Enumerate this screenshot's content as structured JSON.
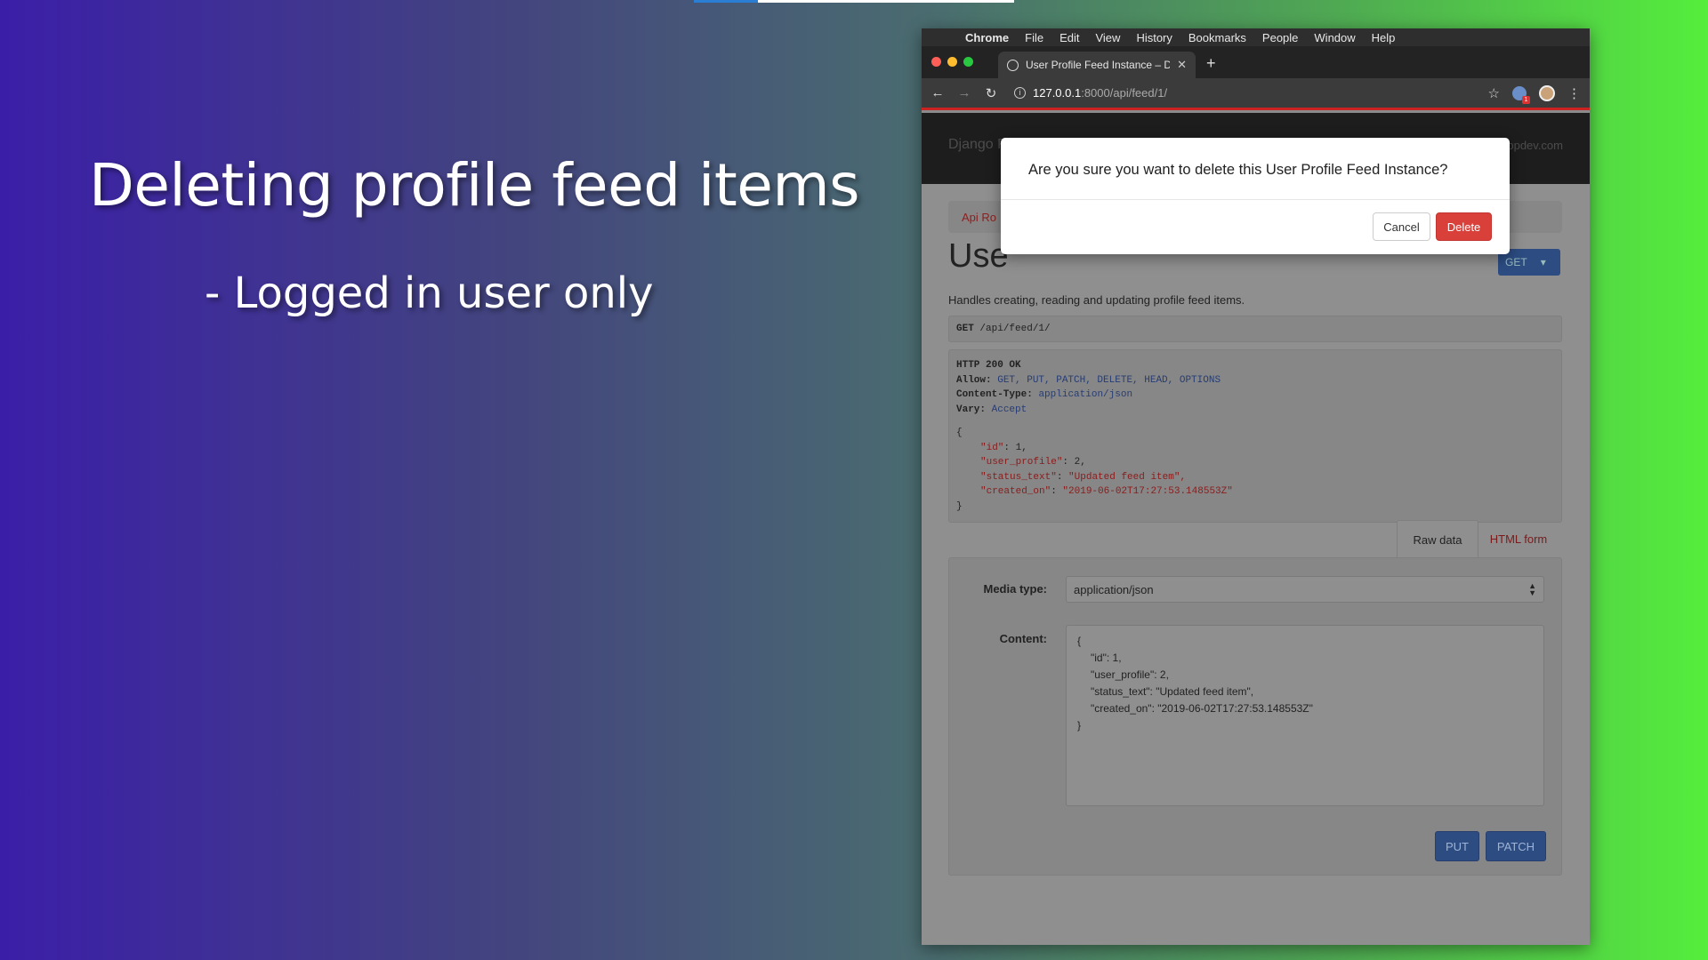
{
  "slide": {
    "title": "Deleting profile feed items",
    "bullet": "- Logged in user only"
  },
  "menubar": {
    "apple_icon": "apple-icon",
    "items": [
      "Chrome",
      "File",
      "Edit",
      "View",
      "History",
      "Bookmarks",
      "People",
      "Window",
      "Help"
    ]
  },
  "browser": {
    "tab_title": "User Profile Feed Instance – Dj",
    "url_host": "127.0.0.1",
    "url_path": ":8000/api/feed/1/",
    "extension_badge": "1"
  },
  "drf": {
    "brand": "Django REST framework",
    "user_email": "brooke@londonappdev.com",
    "breadcrumb": "Api Ro",
    "heading": "Use",
    "get_button": "GET",
    "description": "Handles creating, reading and updating profile feed items.",
    "request_method": "GET",
    "request_path": "/api/feed/1/",
    "response": {
      "status": "HTTP 200 OK",
      "allow_key": "Allow:",
      "allow_val": "GET, PUT, PATCH, DELETE, HEAD, OPTIONS",
      "ct_key": "Content-Type:",
      "ct_val": "application/json",
      "vary_key": "Vary:",
      "vary_val": "Accept",
      "open_brace": "{",
      "close_brace": "}",
      "lines": [
        {
          "key": "\"id\"",
          "val": " 1,"
        },
        {
          "key": "\"user_profile\"",
          "val": " 2,"
        },
        {
          "key": "\"status_text\"",
          "val": " \"Updated feed item\","
        },
        {
          "key": "\"created_on\"",
          "val": " \"2019-06-02T17:27:53.148553Z\""
        }
      ]
    },
    "tab_raw": "Raw data",
    "tab_html": "HTML form",
    "media_type_label": "Media type:",
    "media_type_value": "application/json",
    "content_label": "Content:",
    "content_lines": {
      "open": "{",
      "l1": "\"id\": 1,",
      "l2": "\"user_profile\": 2,",
      "l3": "\"status_text\": \"Updated feed item\",",
      "l4": "\"created_on\": \"2019-06-02T17:27:53.148553Z\"",
      "close": "}"
    },
    "put_button": "PUT",
    "patch_button": "PATCH"
  },
  "modal": {
    "question": "Are you sure you want to delete this User Profile Feed Instance?",
    "cancel": "Cancel",
    "delete": "Delete"
  },
  "colors": {
    "delete_red": "#d9403a",
    "primary_blue": "#2c4c82",
    "close_dot": "#ff5f57",
    "min_dot": "#febc2e",
    "max_dot": "#28c840"
  }
}
